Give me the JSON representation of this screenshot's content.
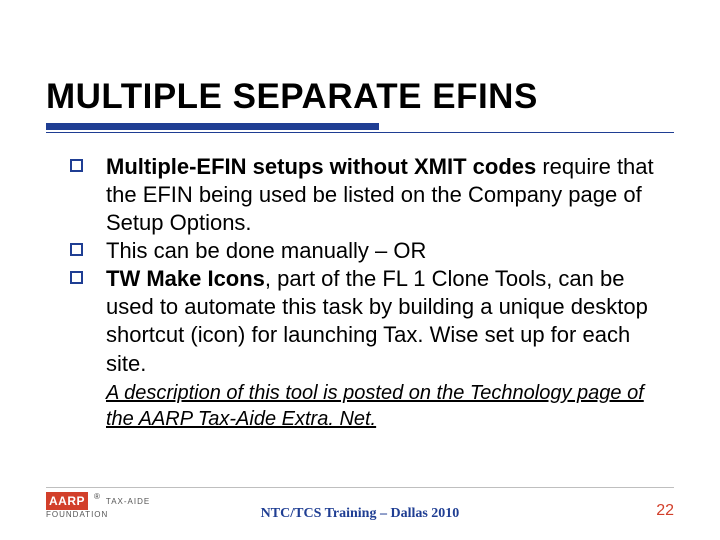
{
  "title": "MULTIPLE SEPARATE EFINS",
  "bullets": [
    {
      "bold_lead": "Multiple-EFIN setups without XMIT codes",
      "rest": " require that the EFIN being used be listed on the Company page of Setup Options."
    },
    {
      "bold_lead": "",
      "rest": "This can be done manually – OR"
    },
    {
      "bold_lead": "TW Make Icons",
      "rest": ", part of the FL 1 Clone Tools, can be used to automate this task by building a unique desktop shortcut (icon) for launching Tax. Wise set up for each site."
    }
  ],
  "note": "A description of this tool is posted on the Technology page of the AARP Tax-Aide Extra. Net.",
  "logo": {
    "brand": "AARP",
    "sub": "TAX-AIDE",
    "foundation": "FOUNDATION"
  },
  "footer_center": "NTC/TCS Training – Dallas 2010",
  "page_number": "22"
}
